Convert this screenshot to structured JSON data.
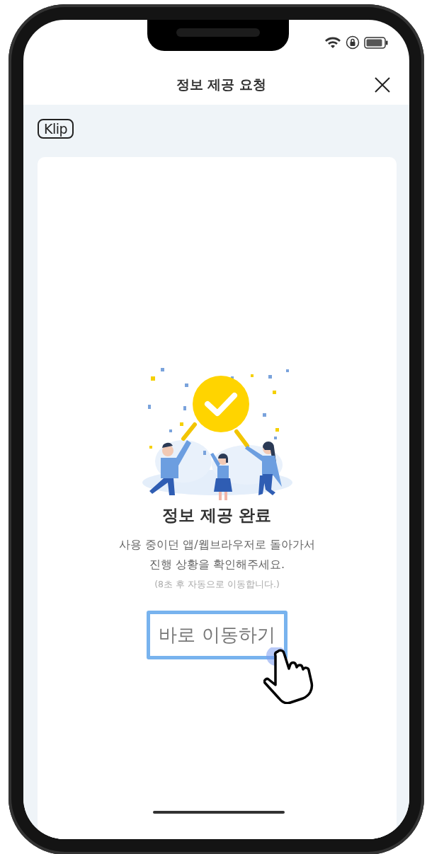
{
  "header": {
    "title": "정보 제공 요청"
  },
  "logo": {
    "text": "Klip"
  },
  "result": {
    "title": "정보 제공 완료",
    "message_lines": [
      "사용 중이던 앱/웹브라우저로 돌아가서",
      "진행 상황을 확인해주세요."
    ],
    "note": "(8초 후 자동으로 이동합니다.)",
    "button": {
      "label": "바로 이동하기",
      "highlighted": true
    }
  }
}
